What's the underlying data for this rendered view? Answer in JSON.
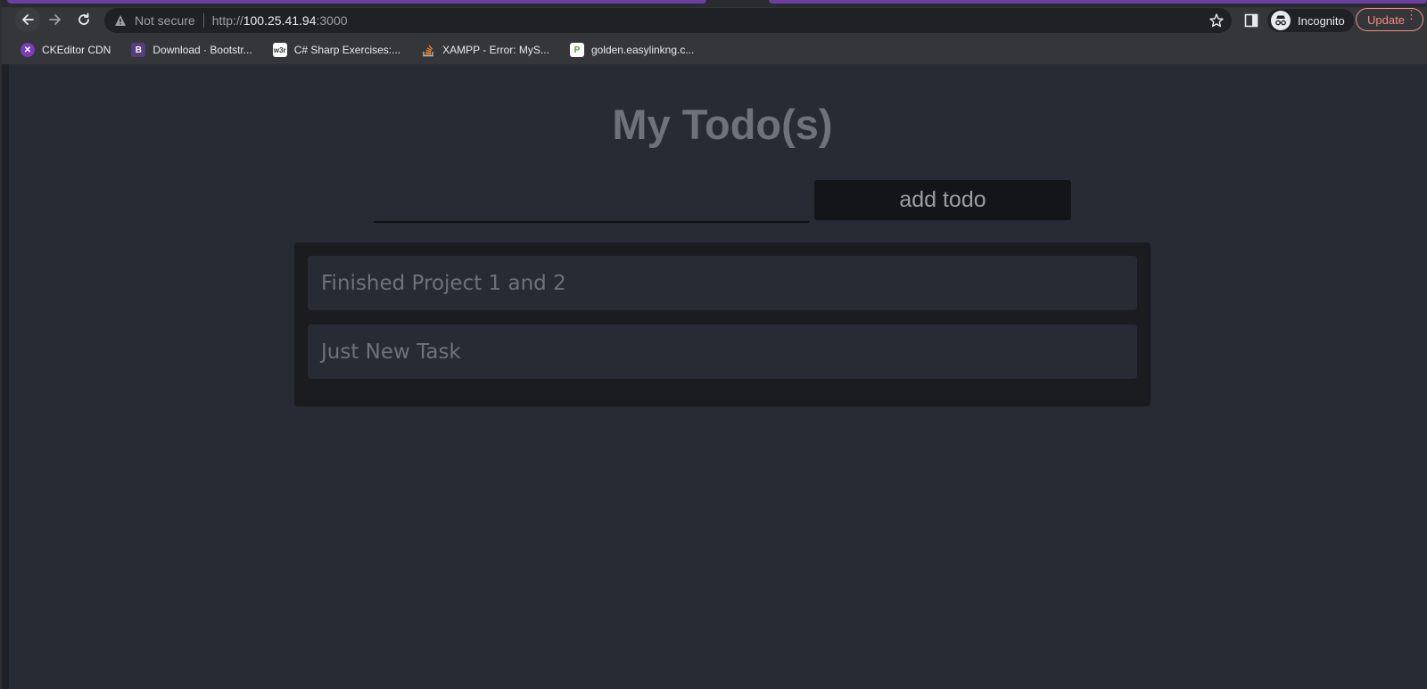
{
  "browser": {
    "security_label": "Not secure",
    "url_scheme": "http://",
    "url_host": "100.25.41.94",
    "url_port": ":3000",
    "incognito_label": "Incognito",
    "update_label": "Update"
  },
  "bookmarks": [
    {
      "label": "CKEditor CDN",
      "icon": "ckeditor-icon",
      "color": "#7d3cb5"
    },
    {
      "label": "Download · Bootstr...",
      "icon": "bootstrap-icon",
      "color": "#563d7c"
    },
    {
      "label": "C# Sharp Exercises:...",
      "icon": "w3r-icon",
      "color": "#ffffff"
    },
    {
      "label": "XAMPP - Error: MyS...",
      "icon": "stackoverflow-icon",
      "color": "#f48024"
    },
    {
      "label": "golden.easylinkng.c...",
      "icon": "golden-icon",
      "color": "#5aa02c"
    }
  ],
  "page": {
    "title": "My Todo(s)",
    "input_value": "",
    "add_button_label": "add todo",
    "todos": [
      {
        "text": "Finished Project 1 and 2"
      },
      {
        "text": "Just New Task"
      }
    ]
  },
  "colors": {
    "background": "#272b34",
    "panel": "#1a1c20",
    "text_muted": "#6f7278",
    "tab_accent": "#6b3fa0"
  }
}
